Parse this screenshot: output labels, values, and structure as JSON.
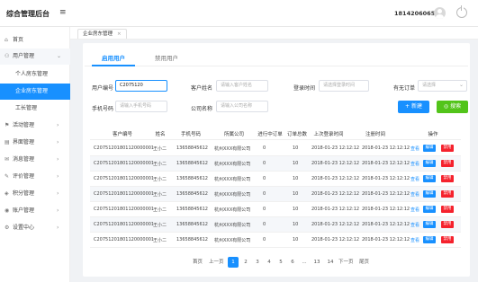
{
  "header": {
    "brand": "综合管理后台",
    "menu_icon": "menu-icon",
    "user_phone": "18142060652",
    "avatar_icon": "avatar-icon",
    "logout_icon": "power-icon"
  },
  "sidebar": {
    "items": [
      {
        "label": "首页",
        "icon": "⌂"
      },
      {
        "label": "用户管理",
        "icon": "⚇",
        "arrow": "⌄"
      },
      {
        "label": "个人房东管理"
      },
      {
        "label": "企业房东管理"
      },
      {
        "label": "工长管理"
      },
      {
        "label": "活动管理",
        "icon": "⚑",
        "arrow": "›"
      },
      {
        "label": "界面管理",
        "icon": "▤",
        "arrow": "›"
      },
      {
        "label": "消息管理",
        "icon": "✉",
        "arrow": "›"
      },
      {
        "label": "评价管理",
        "icon": "✎",
        "arrow": "›"
      },
      {
        "label": "积分管理",
        "icon": "◈",
        "arrow": "›"
      },
      {
        "label": "账户管理",
        "icon": "◉",
        "arrow": "›"
      },
      {
        "label": "设置中心",
        "icon": "⚙",
        "arrow": "›"
      }
    ]
  },
  "tabbar": {
    "tab_label": "企业房东管理",
    "close": "×"
  },
  "subtabs": {
    "enabled": "启用用户",
    "disabled": "禁用用户"
  },
  "filters": {
    "user_id_label": "用户编号",
    "user_id_value": "C2075120",
    "name_label": "客户姓名",
    "name_placeholder": "请输入客户姓名",
    "login_label": "登录时间",
    "login_placeholder": "请选择登录时间",
    "order_label": "有无订单",
    "order_placeholder": "请选择",
    "phone_label": "手机号码",
    "phone_placeholder": "请输入手机号码",
    "company_label": "公司名称",
    "company_placeholder": "请输入公司名称",
    "add_button": "+ 新建",
    "search_button": "◎ 搜索"
  },
  "table": {
    "headers": [
      "客户编号",
      "姓名",
      "手机号码",
      "所属公司",
      "进行中订单",
      "订单总数",
      "上次登录时间",
      "注册时间",
      "操作"
    ],
    "rows": [
      [
        "C20751201801120000001",
        "王小二",
        "13658845612",
        "杭州XXX有限公司",
        "0",
        "10",
        "2018-01-23  12:12:12",
        "2018-01-23  12:12:12"
      ],
      [
        "C20751201801120000001",
        "王小二",
        "13658845612",
        "杭州XXX有限公司",
        "0",
        "10",
        "2018-01-23  12:12:12",
        "2018-01-23  12:12:12"
      ],
      [
        "C20751201801120000001",
        "王小二",
        "13658845612",
        "杭州XXX有限公司",
        "0",
        "10",
        "2018-01-23  12:12:12",
        "2018-01-23  12:12:12"
      ],
      [
        "C20751201801120000001",
        "王小二",
        "13658845612",
        "杭州XXX有限公司",
        "0",
        "10",
        "2018-01-23  12:12:12",
        "2018-01-23  12:12:12"
      ],
      [
        "C20751201801120000001",
        "王小二",
        "13658845612",
        "杭州XXX有限公司",
        "0",
        "10",
        "2018-01-23  12:12:12",
        "2018-01-23  12:12:12"
      ],
      [
        "C20751201801120000001",
        "王小二",
        "13658845612",
        "杭州XXX有限公司",
        "0",
        "10",
        "2018-01-23  12:12:12",
        "2018-01-23  12:12:12"
      ],
      [
        "C20751201801120000001",
        "王小二",
        "13658845612",
        "杭州XXX有限公司",
        "0",
        "10",
        "2018-01-23  12:12:12",
        "2018-01-23  12:12:12"
      ]
    ],
    "op_view": "查看",
    "op_edit": "编辑",
    "op_delete": "禁用"
  },
  "pagination": {
    "first": "首页",
    "prev": "上一页",
    "pages": [
      "1",
      "2",
      "3",
      "4",
      "5",
      "6",
      "...",
      "13",
      "14"
    ],
    "next": "下一页",
    "last": "尾页",
    "active_page": "1"
  },
  "colors": {
    "primary": "#1890ff",
    "success": "#52c41a",
    "danger": "#f5222d"
  }
}
